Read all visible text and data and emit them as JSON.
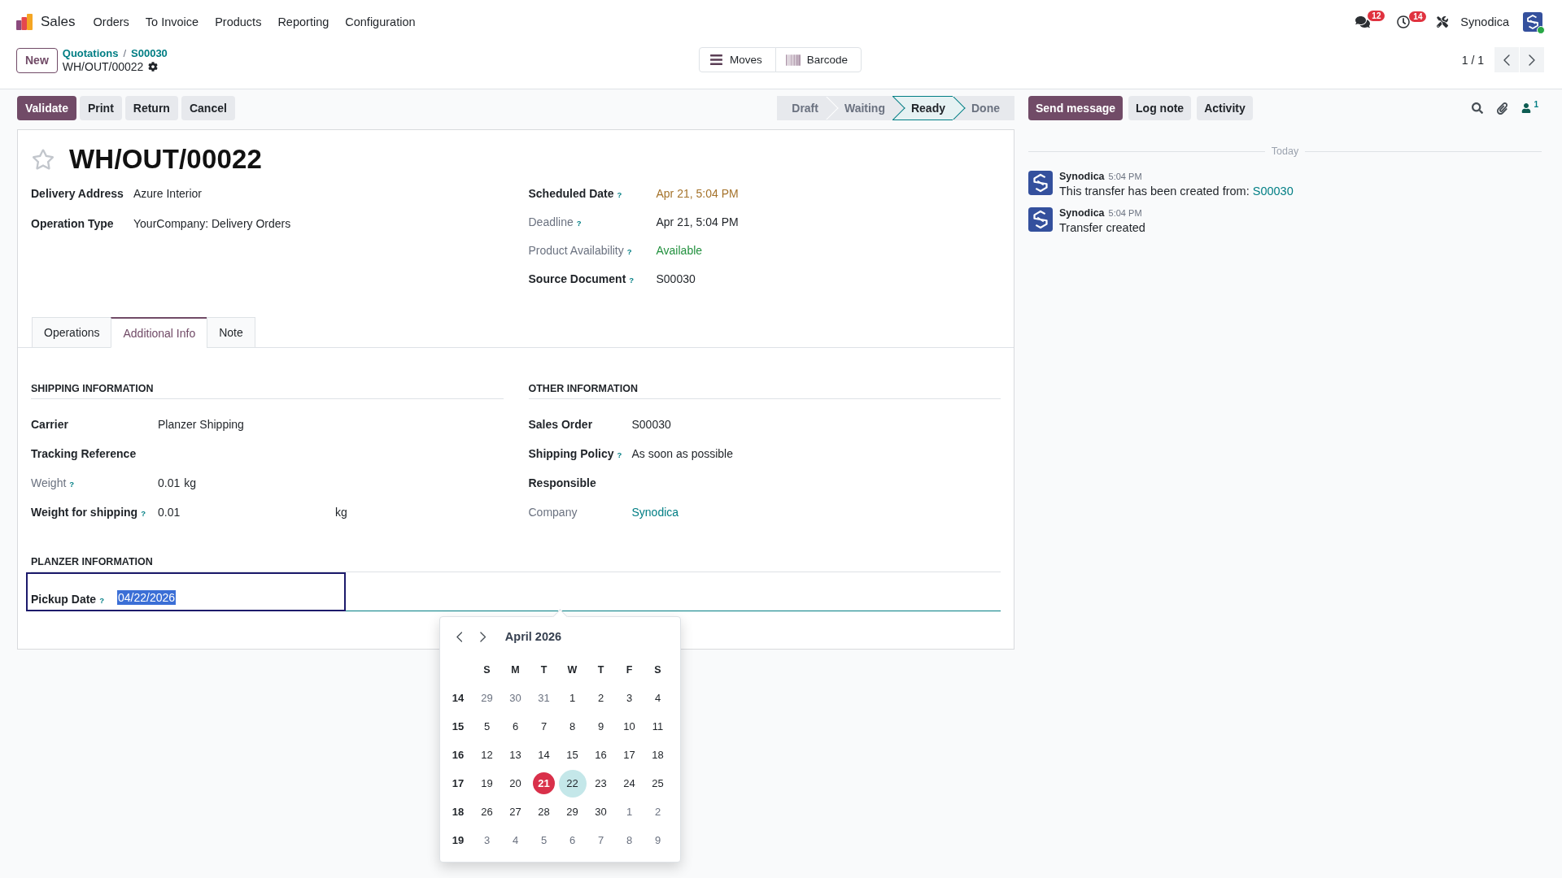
{
  "navbar": {
    "app_name": "Sales",
    "menu": [
      "Orders",
      "To Invoice",
      "Products",
      "Reporting",
      "Configuration"
    ],
    "messages_badge": "12",
    "activities_badge": "14",
    "user_name": "Synodica",
    "user_online": true
  },
  "control_panel": {
    "new_button": "New",
    "breadcrumbs": [
      "Quotations",
      "S00030"
    ],
    "breadcrumb_separator": "/",
    "record_name": "WH/OUT/00022",
    "smart_buttons": [
      {
        "kind": "list",
        "label": "Moves"
      },
      {
        "kind": "barcode",
        "label": "Barcode"
      }
    ],
    "pager": "1 / 1"
  },
  "action_buttons": [
    {
      "label": "Validate",
      "primary": true
    },
    {
      "label": "Print",
      "primary": false
    },
    {
      "label": "Return",
      "primary": false
    },
    {
      "label": "Cancel",
      "primary": false
    }
  ],
  "status_bar": [
    {
      "label": "Draft",
      "selected": false
    },
    {
      "label": "Waiting",
      "selected": false
    },
    {
      "label": "Ready",
      "selected": true
    },
    {
      "label": "Done",
      "selected": false
    }
  ],
  "form": {
    "starred": false,
    "title": "WH/OUT/00022",
    "left_fields": [
      {
        "label": "Delivery Address",
        "value": "Azure Interior",
        "readonly": false,
        "kind": "plain"
      },
      {
        "label": "Operation Type",
        "value": "YourCompany: Delivery Orders",
        "readonly": false,
        "kind": "plain"
      }
    ],
    "right_fields": [
      {
        "label": "Scheduled Date",
        "help": "?",
        "value": "Apr 21, 5:04 PM",
        "readonly": false,
        "kind": "warning"
      },
      {
        "label": "Deadline",
        "help": "?",
        "value": "Apr 21, 5:04 PM",
        "readonly": true,
        "kind": "plain"
      },
      {
        "label": "Product Availability",
        "help": "?",
        "value": "Available",
        "readonly": true,
        "kind": "success"
      },
      {
        "label": "Source Document",
        "help": "?",
        "value": "S00030",
        "readonly": false,
        "kind": "plain"
      }
    ],
    "tabs": [
      {
        "label": "Operations",
        "selected": false
      },
      {
        "label": "Additional Info",
        "selected": true
      },
      {
        "label": "Note",
        "selected": false
      }
    ],
    "sections": [
      {
        "title": "SHIPPING INFORMATION",
        "fields": [
          {
            "label": "Carrier",
            "value": "Planzer Shipping",
            "readonly": false,
            "kind": "plain"
          },
          {
            "label": "Tracking Reference",
            "readonly": false
          },
          {
            "label": "Weight",
            "help": "?",
            "value": "0.01",
            "unit": "kg",
            "readonly": true,
            "kind": "plain"
          },
          {
            "label": "Weight for shipping",
            "help": "?",
            "value": "0.01",
            "unit": "kg",
            "readonly": false,
            "kind": "plain"
          }
        ]
      },
      {
        "title": "OTHER INFORMATION",
        "fields": [
          {
            "label": "Sales Order",
            "value": "S00030",
            "readonly": false,
            "kind": "plain"
          },
          {
            "label": "Shipping Policy",
            "help": "?",
            "value": "As soon as possible",
            "readonly": false,
            "kind": "plain"
          },
          {
            "label": "Responsible",
            "readonly": false
          },
          {
            "label": "Company",
            "value": "Synodica",
            "readonly": true,
            "kind": "link"
          }
        ]
      }
    ],
    "planzer_section": {
      "title": "PLANZER INFORMATION",
      "pickup_field": {
        "label": "Pickup Date",
        "help": "?",
        "value": "04/22/2026",
        "focused": true,
        "highlighted": true
      }
    }
  },
  "date_picker": {
    "month": "April 2026",
    "weekdays": [
      "S",
      "M",
      "T",
      "W",
      "T",
      "F",
      "S"
    ],
    "weeks": [
      {
        "number": "14",
        "days": [
          {
            "label": "29",
            "outside": true,
            "today": false,
            "selected": false
          },
          {
            "label": "30",
            "outside": true,
            "today": false,
            "selected": false
          },
          {
            "label": "31",
            "outside": true,
            "today": false,
            "selected": false
          },
          {
            "label": "1",
            "outside": false,
            "today": false,
            "selected": false
          },
          {
            "label": "2",
            "outside": false,
            "today": false,
            "selected": false
          },
          {
            "label": "3",
            "outside": false,
            "today": false,
            "selected": false
          },
          {
            "label": "4",
            "outside": false,
            "today": false,
            "selected": false
          }
        ]
      },
      {
        "number": "15",
        "days": [
          {
            "label": "5",
            "outside": false,
            "today": false,
            "selected": false
          },
          {
            "label": "6",
            "outside": false,
            "today": false,
            "selected": false
          },
          {
            "label": "7",
            "outside": false,
            "today": false,
            "selected": false
          },
          {
            "label": "8",
            "outside": false,
            "today": false,
            "selected": false
          },
          {
            "label": "9",
            "outside": false,
            "today": false,
            "selected": false
          },
          {
            "label": "10",
            "outside": false,
            "today": false,
            "selected": false
          },
          {
            "label": "11",
            "outside": false,
            "today": false,
            "selected": false
          }
        ]
      },
      {
        "number": "16",
        "days": [
          {
            "label": "12",
            "outside": false,
            "today": false,
            "selected": false
          },
          {
            "label": "13",
            "outside": false,
            "today": false,
            "selected": false
          },
          {
            "label": "14",
            "outside": false,
            "today": false,
            "selected": false
          },
          {
            "label": "15",
            "outside": false,
            "today": false,
            "selected": false
          },
          {
            "label": "16",
            "outside": false,
            "today": false,
            "selected": false
          },
          {
            "label": "17",
            "outside": false,
            "today": false,
            "selected": false
          },
          {
            "label": "18",
            "outside": false,
            "today": false,
            "selected": false
          }
        ]
      },
      {
        "number": "17",
        "days": [
          {
            "label": "19",
            "outside": false,
            "today": false,
            "selected": false
          },
          {
            "label": "20",
            "outside": false,
            "today": false,
            "selected": false
          },
          {
            "label": "21",
            "outside": false,
            "today": true,
            "selected": false
          },
          {
            "label": "22",
            "outside": false,
            "today": false,
            "selected": true
          },
          {
            "label": "23",
            "outside": false,
            "today": false,
            "selected": false
          },
          {
            "label": "24",
            "outside": false,
            "today": false,
            "selected": false
          },
          {
            "label": "25",
            "outside": false,
            "today": false,
            "selected": false
          }
        ]
      },
      {
        "number": "18",
        "days": [
          {
            "label": "26",
            "outside": false,
            "today": false,
            "selected": false
          },
          {
            "label": "27",
            "outside": false,
            "today": false,
            "selected": false
          },
          {
            "label": "28",
            "outside": false,
            "today": false,
            "selected": false
          },
          {
            "label": "29",
            "outside": false,
            "today": false,
            "selected": false
          },
          {
            "label": "30",
            "outside": false,
            "today": false,
            "selected": false
          },
          {
            "label": "1",
            "outside": true,
            "today": false,
            "selected": false
          },
          {
            "label": "2",
            "outside": true,
            "today": false,
            "selected": false
          }
        ]
      },
      {
        "number": "19",
        "days": [
          {
            "label": "3",
            "outside": true,
            "today": false,
            "selected": false
          },
          {
            "label": "4",
            "outside": true,
            "today": false,
            "selected": false
          },
          {
            "label": "5",
            "outside": true,
            "today": false,
            "selected": false
          },
          {
            "label": "6",
            "outside": true,
            "today": false,
            "selected": false
          },
          {
            "label": "7",
            "outside": true,
            "today": false,
            "selected": false
          },
          {
            "label": "8",
            "outside": true,
            "today": false,
            "selected": false
          },
          {
            "label": "9",
            "outside": true,
            "today": false,
            "selected": false
          }
        ]
      }
    ]
  },
  "chatter": {
    "buttons": [
      {
        "label": "Send message",
        "primary": true
      },
      {
        "label": "Log note",
        "primary": false
      },
      {
        "label": "Activity",
        "primary": false
      }
    ],
    "followers_count": "1",
    "divider": "Today",
    "messages": [
      {
        "author": "Synodica",
        "time": "5:04 PM",
        "body": "This transfer has been created from: ",
        "link": "S00030"
      },
      {
        "author": "Synodica",
        "time": "5:04 PM",
        "body": "Transfer created"
      }
    ]
  }
}
